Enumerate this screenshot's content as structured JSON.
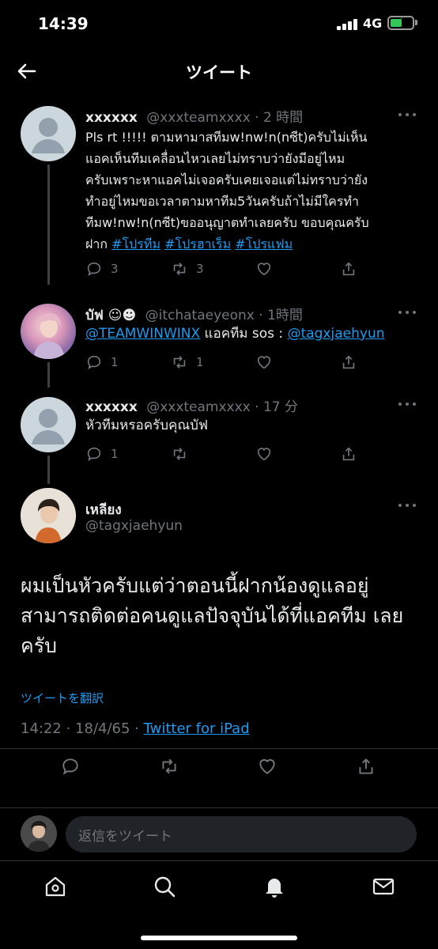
{
  "status_bar": {
    "time": "14:39",
    "network": "4G"
  },
  "header": {
    "title": "ツイート"
  },
  "tweets": [
    {
      "name": "xxxxxx",
      "handle": "@xxxteamxxxx",
      "sep": " · ",
      "time": "2 時間",
      "text_lines": [
        "Pls rt !!!!! ตามหามาสทีมw!nw!n(nซีt)ครับไม่เห็น",
        "แอคเห็นทีมเคลื่อนไหวเลยไม่ทราบว่ายังมีอยู่ไหม",
        "ครับเพราะหาแอคไม่เจอครับเคยเจอแต่ไม่ทราบว่ายัง",
        "ทำอยู่ไหมขอเวลาตามหาทีม5วันครับถ้าไม่มีใครทำ",
        "ทีมw!nw!n(nซีt)ขออนุญาตทำเลยครับ ขอบคุณครับ"
      ],
      "last_line_prefix": "ฝาก ",
      "hashtags": [
        "#โปรทีม",
        "#โปรฮาเร็ม",
        "#โปรแฟม"
      ],
      "reply_count": "3",
      "retweet_count": "3"
    },
    {
      "name": "บัฟ ☺︎☻︎",
      "handle": "@itchataeyeonx",
      "sep": " · ",
      "time": "1時間",
      "mention_1": "@TEAMWINWINX",
      "mid_text": " แอคทีม sos : ",
      "mention_2": "@tagxjaehyun",
      "reply_count": "1",
      "retweet_count": "1"
    },
    {
      "name": "xxxxxx",
      "handle": "@xxxteamxxxx",
      "sep": " · ",
      "time": "17 分",
      "text": "หัวทีมหรอครับคุณบัฟ",
      "reply_count": "1",
      "retweet_count": ""
    }
  ],
  "main_tweet": {
    "name": "เหลียง",
    "handle": "@tagxjaehyun",
    "text": "ผมเป็นหัวครับแต่ว่าตอนนี้ฝากน้องดูแลอยู่ สามารถติดต่อคนดูแลปัจจุบันได้ที่แอคทีม เลยครับ",
    "translate": "ツイートを翻訳",
    "timestamp": "14:22 · 18/4/65 · ",
    "source": "Twitter for iPad"
  },
  "reply_bar": {
    "placeholder": "返信をツイート"
  },
  "colors": {
    "accent": "#1d9bf0",
    "muted": "#71767b",
    "background": "#000000"
  },
  "icons": [
    "back-arrow-icon",
    "more-icon",
    "reply-icon",
    "retweet-icon",
    "like-icon",
    "share-icon",
    "home-icon",
    "search-icon",
    "notifications-icon",
    "messages-icon"
  ]
}
